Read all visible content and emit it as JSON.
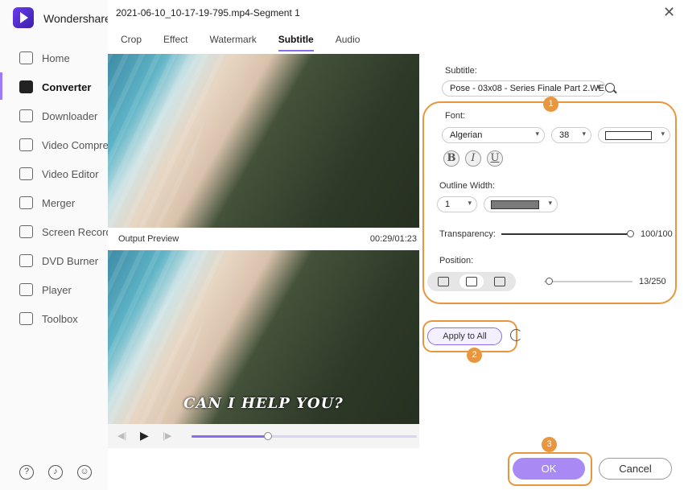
{
  "app": {
    "brand": "Wondershare U",
    "nav": [
      {
        "label": "Home",
        "icon": "home-icon"
      },
      {
        "label": "Converter",
        "icon": "converter-icon",
        "active": true
      },
      {
        "label": "Downloader",
        "icon": "download-icon"
      },
      {
        "label": "Video Compres",
        "icon": "compress-icon"
      },
      {
        "label": "Video Editor",
        "icon": "scissors-icon"
      },
      {
        "label": "Merger",
        "icon": "merge-icon"
      },
      {
        "label": "Screen Recorde",
        "icon": "screen-record-icon"
      },
      {
        "label": "DVD Burner",
        "icon": "disc-icon"
      },
      {
        "label": "Player",
        "icon": "play-icon"
      },
      {
        "label": "Toolbox",
        "icon": "grid-icon"
      }
    ],
    "bottom_icons": [
      "help-icon",
      "bell-icon",
      "feedback-icon"
    ]
  },
  "dialog": {
    "title": "2021-06-10_10-17-19-795.mp4-Segment 1",
    "close_glyph": "✕",
    "tabs": [
      {
        "label": "Crop"
      },
      {
        "label": "Effect"
      },
      {
        "label": "Watermark"
      },
      {
        "label": "Subtitle",
        "active": true
      },
      {
        "label": "Audio"
      }
    ],
    "preview": {
      "label": "Output Preview",
      "time": "00:29/01:23",
      "subtitle_text": "CAN I HELP YOU?",
      "progress": 0.34
    },
    "controls": {
      "prev": "◀|",
      "play": "▶",
      "next": "|▶"
    },
    "subtitle": {
      "label": "Subtitle:",
      "file": "Pose - 03x08 - Series Finale Part 2.WE"
    },
    "font": {
      "label": "Font:",
      "family": "Algerian",
      "size": "38",
      "color": "#ffffff",
      "styles": [
        "B",
        "I",
        "U"
      ]
    },
    "outline": {
      "label": "Outline Width:",
      "width": "1",
      "color": "#7a7a7a"
    },
    "transparency": {
      "label": "Transparency:",
      "value": "100/100",
      "level": 1.0
    },
    "position": {
      "label": "Position:",
      "value": "13/250",
      "level": 0.052,
      "options": [
        "bottom-align-icon",
        "middle-align-icon",
        "top-align-icon"
      ],
      "active_index": 1
    },
    "apply_all_label": "Apply to All",
    "ok_label": "OK",
    "cancel_label": "Cancel",
    "callouts": [
      "1",
      "2",
      "3"
    ],
    "accent_color": "#8a6cf0",
    "callout_color": "#e9963e"
  }
}
